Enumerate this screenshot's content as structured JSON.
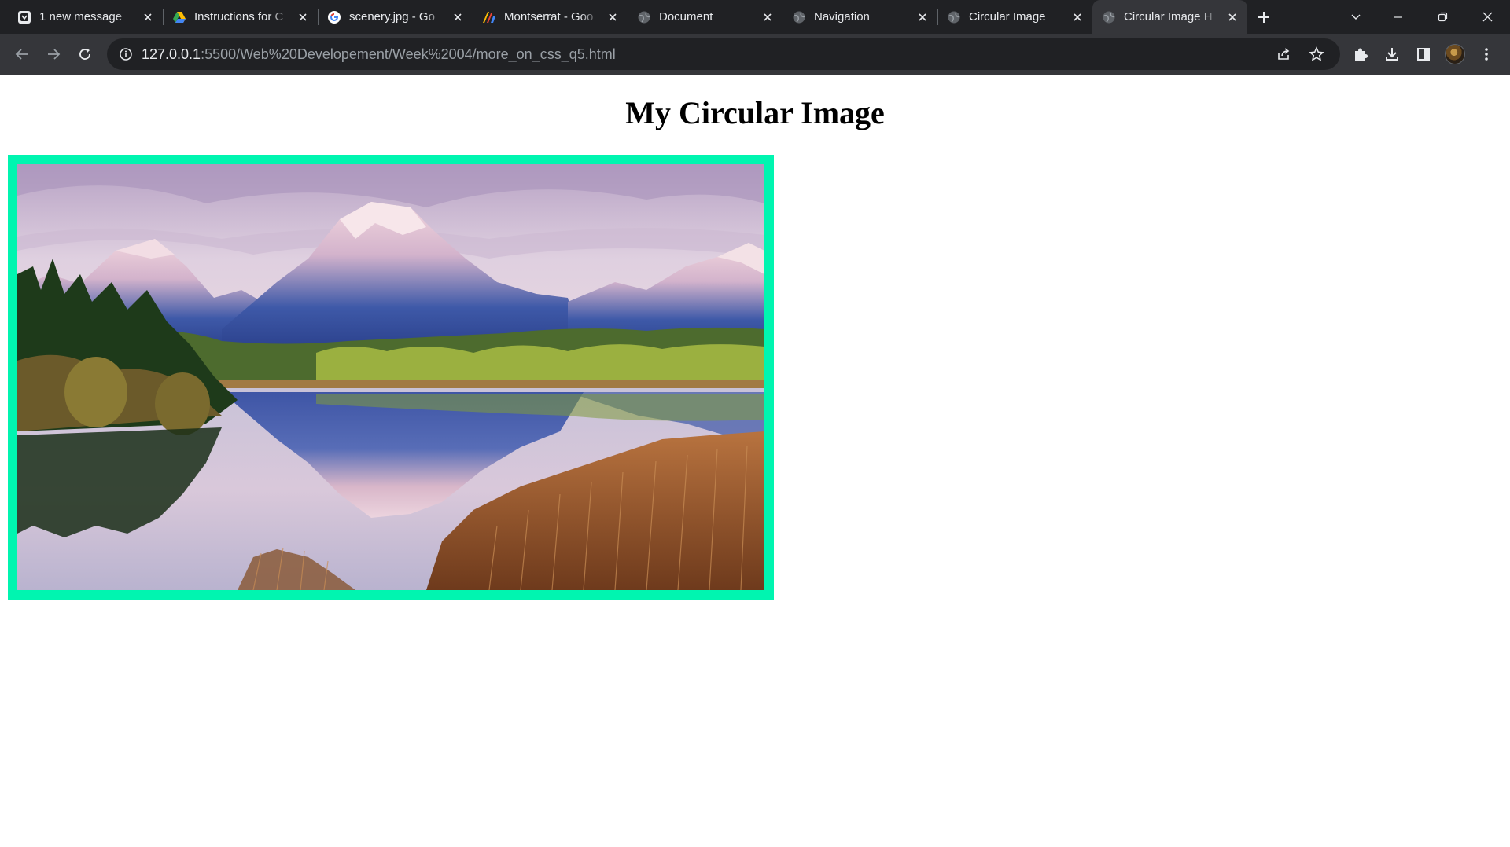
{
  "browser": {
    "tabs": [
      {
        "title": "1 new message",
        "icon": "mail-app-icon",
        "active": false
      },
      {
        "title": "Instructions for C",
        "icon": "google-drive-icon",
        "active": false
      },
      {
        "title": "scenery.jpg - Go",
        "icon": "google-icon",
        "active": false
      },
      {
        "title": "Montserrat - Goo",
        "icon": "google-fonts-icon",
        "active": false
      },
      {
        "title": "Document",
        "icon": "globe-icon",
        "active": false
      },
      {
        "title": "Navigation",
        "icon": "globe-icon",
        "active": false
      },
      {
        "title": "Circular Image",
        "icon": "globe-icon",
        "active": false
      },
      {
        "title": "Circular Image H",
        "icon": "globe-icon",
        "active": true
      }
    ],
    "url_host": "127.0.0.1",
    "url_rest": ":5500/Web%20Developement/Week%2004/more_on_css_q5.html"
  },
  "page": {
    "title": "My Circular Image",
    "image_alt": "scenery",
    "image_border_color": "#00f5b0"
  },
  "colors": {
    "tabstrip_bg": "#202124",
    "toolbar_bg": "#35363a",
    "omnibox_bg": "#202124",
    "page_bg": "#ffffff"
  }
}
